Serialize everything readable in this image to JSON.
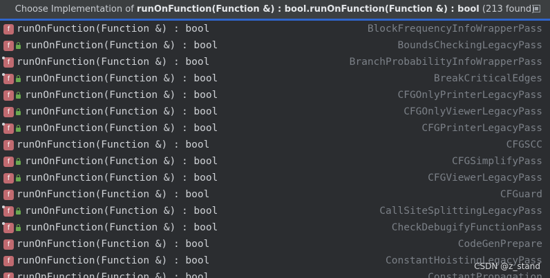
{
  "popup": {
    "title_prefix": "Choose Implementation of ",
    "title_bold": "runOnFunction(Function &) : bool.runOnFunction(Function &) : bool",
    "title_suffix": " (213 found)"
  },
  "rows": [
    {
      "method": "runOnFunction(Function &) : bool",
      "class": "BlockFrequencyInfoWrapperPass",
      "locked": false,
      "pinned": false
    },
    {
      "method": "runOnFunction(Function &) : bool",
      "class": "BoundsCheckingLegacyPass",
      "locked": true,
      "pinned": false
    },
    {
      "method": "runOnFunction(Function &) : bool",
      "class": "BranchProbabilityInfoWrapperPass",
      "locked": false,
      "pinned": true
    },
    {
      "method": "runOnFunction(Function &) : bool",
      "class": "BreakCriticalEdges",
      "locked": true,
      "pinned": true
    },
    {
      "method": "runOnFunction(Function &) : bool",
      "class": "CFGOnlyPrinterLegacyPass",
      "locked": true,
      "pinned": false
    },
    {
      "method": "runOnFunction(Function &) : bool",
      "class": "CFGOnlyViewerLegacyPass",
      "locked": true,
      "pinned": false
    },
    {
      "method": "runOnFunction(Function &) : bool",
      "class": "CFGPrinterLegacyPass",
      "locked": true,
      "pinned": true
    },
    {
      "method": "runOnFunction(Function &) : bool",
      "class": "CFGSCC",
      "locked": false,
      "pinned": false
    },
    {
      "method": "runOnFunction(Function &) : bool",
      "class": "CFGSimplifyPass",
      "locked": true,
      "pinned": false
    },
    {
      "method": "runOnFunction(Function &) : bool",
      "class": "CFGViewerLegacyPass",
      "locked": true,
      "pinned": false
    },
    {
      "method": "runOnFunction(Function &) : bool",
      "class": "CFGuard",
      "locked": false,
      "pinned": false
    },
    {
      "method": "runOnFunction(Function &) : bool",
      "class": "CallSiteSplittingLegacyPass",
      "locked": true,
      "pinned": true
    },
    {
      "method": "runOnFunction(Function &) : bool",
      "class": "CheckDebugifyFunctionPass",
      "locked": true,
      "pinned": true
    },
    {
      "method": "runOnFunction(Function &) : bool",
      "class": "CodeGenPrepare",
      "locked": false,
      "pinned": false
    },
    {
      "method": "runOnFunction(Function &) : bool",
      "class": "ConstantHoistingLegacyPass",
      "locked": false,
      "pinned": false
    },
    {
      "method": "runOnFunction(Function &) : bool",
      "class": "ConstantPropagation",
      "locked": false,
      "pinned": false
    }
  ],
  "icon_letter": "f",
  "watermark": "CSDN @z_stand",
  "colors": {
    "accent": "#2f65ca",
    "function_icon": "#c06a70",
    "lock": "#6aa84f"
  }
}
